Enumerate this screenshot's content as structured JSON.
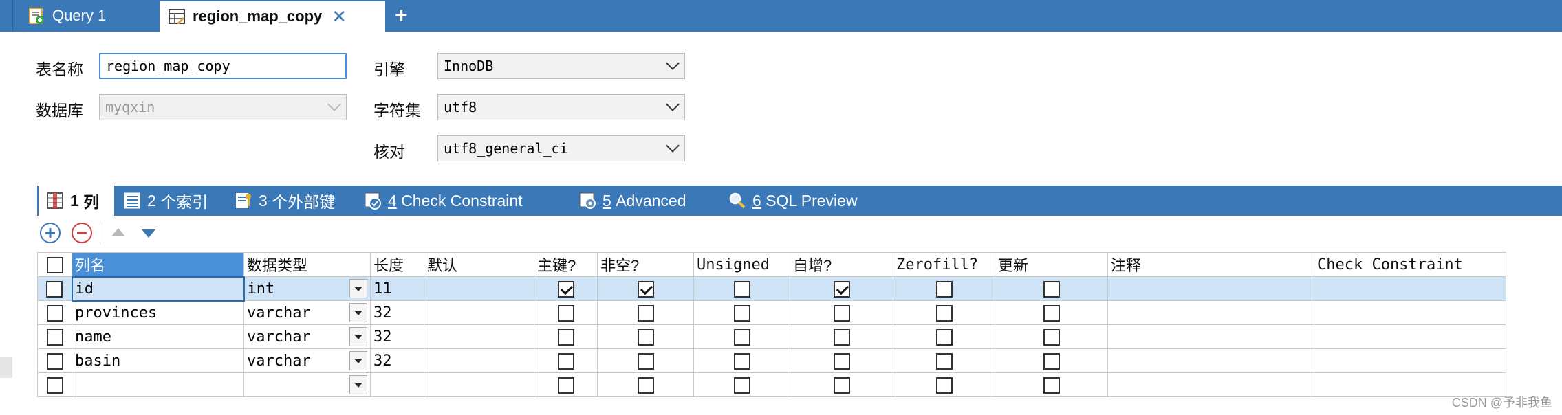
{
  "tabs": {
    "query": "Query 1",
    "active": "region_map_copy",
    "close": "✕",
    "new": "+"
  },
  "form": {
    "table_name_label": "表名称",
    "table_name_value": "region_map_copy",
    "database_label": "数据库",
    "database_value": "myqxin",
    "engine_label": "引擎",
    "engine_value": "InnoDB",
    "charset_label": "字符集",
    "charset_value": "utf8",
    "collation_label": "核对",
    "collation_value": "utf8_general_ci"
  },
  "subtabs": [
    {
      "num": "1",
      "label": "列"
    },
    {
      "num": "2",
      "label": "个索引"
    },
    {
      "num": "3",
      "label": "个外部键"
    },
    {
      "num": "4",
      "label": "Check Constraint"
    },
    {
      "num": "5",
      "label": "Advanced"
    },
    {
      "num": "6",
      "label": "SQL Preview"
    }
  ],
  "grid": {
    "headers": {
      "name": "列名",
      "type": "数据类型",
      "length": "长度",
      "default": "默认",
      "pk": "主键?",
      "notnull": "非空?",
      "unsigned": "Unsigned",
      "autoinc": "自增?",
      "zerofill": "Zerofill?",
      "update": "更新",
      "comment": "注释",
      "check": "Check Constraint"
    },
    "rows": [
      {
        "name": "id",
        "type": "int",
        "length": "11",
        "pk": true,
        "notnull": true,
        "unsigned": false,
        "autoinc": true,
        "zerofill": false,
        "update": false
      },
      {
        "name": "provinces",
        "type": "varchar",
        "length": "32",
        "pk": false,
        "notnull": false,
        "unsigned": false,
        "autoinc": false,
        "zerofill": false,
        "update": false
      },
      {
        "name": "name",
        "type": "varchar",
        "length": "32",
        "pk": false,
        "notnull": false,
        "unsigned": false,
        "autoinc": false,
        "zerofill": false,
        "update": false
      },
      {
        "name": "basin",
        "type": "varchar",
        "length": "32",
        "pk": false,
        "notnull": false,
        "unsigned": false,
        "autoinc": false,
        "zerofill": false,
        "update": false
      },
      {
        "name": "",
        "type": "",
        "length": "",
        "pk": false,
        "notnull": false,
        "unsigned": false,
        "autoinc": false,
        "zerofill": false,
        "update": false
      }
    ]
  },
  "watermark": "CSDN @予非我鱼",
  "colors": {
    "accent": "#3a78b8",
    "selection": "#cfe3f7"
  }
}
